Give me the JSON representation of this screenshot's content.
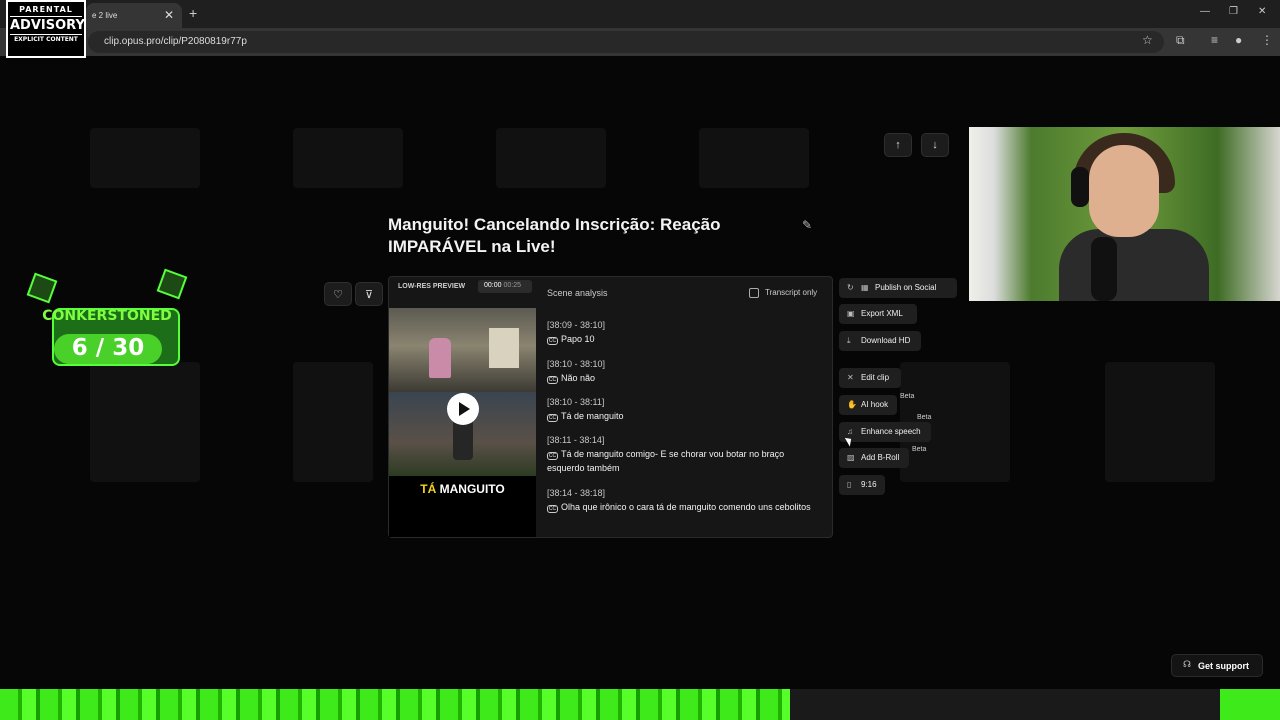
{
  "browser": {
    "tab_title": "e 2 live",
    "url": "clip.opus.pro/clip/P2080819r77p"
  },
  "overlay_logo": {
    "advisory_line1": "PARENTAL",
    "advisory_line2": "ADVISORY",
    "advisory_line3": "EXPLICIT CONTENT",
    "streamer_name": "CONKERSTONED",
    "counter": "6 / 30"
  },
  "modal": {
    "title": "Manguito! Cancelando Inscrição: Reação IMPARÁVEL na Live!",
    "preview_label": "LOW-RES PREVIEW",
    "time_current": "00:00",
    "time_total": "00:25",
    "scene_analysis_label": "Scene analysis",
    "transcript_only_label": "Transcript only",
    "video_caption_part1": "TÁ",
    "video_caption_part2": "MANGUITO",
    "transcript": [
      {
        "time": "[38:09 - 38:10]",
        "text": "Papo 10"
      },
      {
        "time": "[38:10 - 38:10]",
        "text": "Não não"
      },
      {
        "time": "[38:10 - 38:11]",
        "text": "Tá de manguito"
      },
      {
        "time": "[38:11 - 38:14]",
        "text": "Tá de manguito comigo- E se chorar vou botar no braço esquerdo também"
      },
      {
        "time": "[38:14 - 38:18]",
        "text": "Olha que irônico o cara tá de manguito comendo uns cebolitos"
      }
    ],
    "actions": {
      "publish": "Publish on Social",
      "export_xml": "Export XML",
      "download_hd": "Download HD",
      "edit_clip": "Edit clip",
      "ai_hook": "AI hook",
      "enhance_speech": "Enhance speech",
      "add_broll": "Add B-Roll",
      "aspect": "9:16",
      "beta_label": "Beta"
    }
  },
  "get_support": "Get support",
  "colors": {
    "background": "#060606",
    "panel": "#161616",
    "caption_highlight": "#f5d31f",
    "stream_green": "#3eea1a"
  },
  "icons": [
    "refresh-icon",
    "calendar-icon",
    "heart-icon",
    "thumbs-down-icon",
    "arrow-up-icon",
    "arrow-down-icon",
    "pencil-icon",
    "play-icon",
    "close-icon",
    "headset-icon"
  ]
}
